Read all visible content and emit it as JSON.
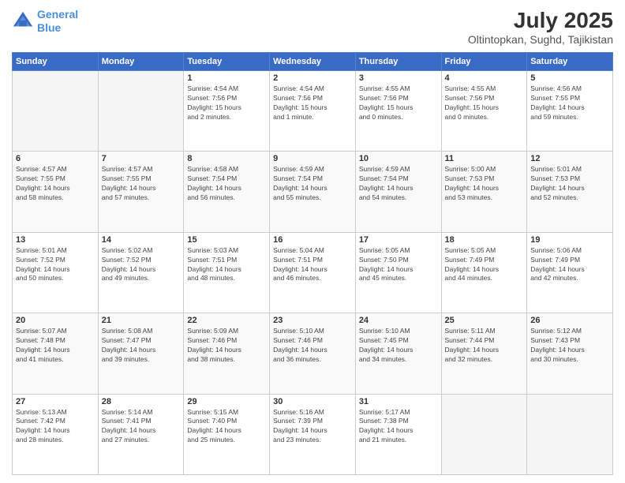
{
  "header": {
    "logo_line1": "General",
    "logo_line2": "Blue",
    "title": "July 2025",
    "subtitle": "Oltintopkan, Sughd, Tajikistan"
  },
  "weekdays": [
    "Sunday",
    "Monday",
    "Tuesday",
    "Wednesday",
    "Thursday",
    "Friday",
    "Saturday"
  ],
  "weeks": [
    [
      {
        "day": "",
        "info": ""
      },
      {
        "day": "",
        "info": ""
      },
      {
        "day": "1",
        "info": "Sunrise: 4:54 AM\nSunset: 7:56 PM\nDaylight: 15 hours\nand 2 minutes."
      },
      {
        "day": "2",
        "info": "Sunrise: 4:54 AM\nSunset: 7:56 PM\nDaylight: 15 hours\nand 1 minute."
      },
      {
        "day": "3",
        "info": "Sunrise: 4:55 AM\nSunset: 7:56 PM\nDaylight: 15 hours\nand 0 minutes."
      },
      {
        "day": "4",
        "info": "Sunrise: 4:55 AM\nSunset: 7:56 PM\nDaylight: 15 hours\nand 0 minutes."
      },
      {
        "day": "5",
        "info": "Sunrise: 4:56 AM\nSunset: 7:55 PM\nDaylight: 14 hours\nand 59 minutes."
      }
    ],
    [
      {
        "day": "6",
        "info": "Sunrise: 4:57 AM\nSunset: 7:55 PM\nDaylight: 14 hours\nand 58 minutes."
      },
      {
        "day": "7",
        "info": "Sunrise: 4:57 AM\nSunset: 7:55 PM\nDaylight: 14 hours\nand 57 minutes."
      },
      {
        "day": "8",
        "info": "Sunrise: 4:58 AM\nSunset: 7:54 PM\nDaylight: 14 hours\nand 56 minutes."
      },
      {
        "day": "9",
        "info": "Sunrise: 4:59 AM\nSunset: 7:54 PM\nDaylight: 14 hours\nand 55 minutes."
      },
      {
        "day": "10",
        "info": "Sunrise: 4:59 AM\nSunset: 7:54 PM\nDaylight: 14 hours\nand 54 minutes."
      },
      {
        "day": "11",
        "info": "Sunrise: 5:00 AM\nSunset: 7:53 PM\nDaylight: 14 hours\nand 53 minutes."
      },
      {
        "day": "12",
        "info": "Sunrise: 5:01 AM\nSunset: 7:53 PM\nDaylight: 14 hours\nand 52 minutes."
      }
    ],
    [
      {
        "day": "13",
        "info": "Sunrise: 5:01 AM\nSunset: 7:52 PM\nDaylight: 14 hours\nand 50 minutes."
      },
      {
        "day": "14",
        "info": "Sunrise: 5:02 AM\nSunset: 7:52 PM\nDaylight: 14 hours\nand 49 minutes."
      },
      {
        "day": "15",
        "info": "Sunrise: 5:03 AM\nSunset: 7:51 PM\nDaylight: 14 hours\nand 48 minutes."
      },
      {
        "day": "16",
        "info": "Sunrise: 5:04 AM\nSunset: 7:51 PM\nDaylight: 14 hours\nand 46 minutes."
      },
      {
        "day": "17",
        "info": "Sunrise: 5:05 AM\nSunset: 7:50 PM\nDaylight: 14 hours\nand 45 minutes."
      },
      {
        "day": "18",
        "info": "Sunrise: 5:05 AM\nSunset: 7:49 PM\nDaylight: 14 hours\nand 44 minutes."
      },
      {
        "day": "19",
        "info": "Sunrise: 5:06 AM\nSunset: 7:49 PM\nDaylight: 14 hours\nand 42 minutes."
      }
    ],
    [
      {
        "day": "20",
        "info": "Sunrise: 5:07 AM\nSunset: 7:48 PM\nDaylight: 14 hours\nand 41 minutes."
      },
      {
        "day": "21",
        "info": "Sunrise: 5:08 AM\nSunset: 7:47 PM\nDaylight: 14 hours\nand 39 minutes."
      },
      {
        "day": "22",
        "info": "Sunrise: 5:09 AM\nSunset: 7:46 PM\nDaylight: 14 hours\nand 38 minutes."
      },
      {
        "day": "23",
        "info": "Sunrise: 5:10 AM\nSunset: 7:46 PM\nDaylight: 14 hours\nand 36 minutes."
      },
      {
        "day": "24",
        "info": "Sunrise: 5:10 AM\nSunset: 7:45 PM\nDaylight: 14 hours\nand 34 minutes."
      },
      {
        "day": "25",
        "info": "Sunrise: 5:11 AM\nSunset: 7:44 PM\nDaylight: 14 hours\nand 32 minutes."
      },
      {
        "day": "26",
        "info": "Sunrise: 5:12 AM\nSunset: 7:43 PM\nDaylight: 14 hours\nand 30 minutes."
      }
    ],
    [
      {
        "day": "27",
        "info": "Sunrise: 5:13 AM\nSunset: 7:42 PM\nDaylight: 14 hours\nand 28 minutes."
      },
      {
        "day": "28",
        "info": "Sunrise: 5:14 AM\nSunset: 7:41 PM\nDaylight: 14 hours\nand 27 minutes."
      },
      {
        "day": "29",
        "info": "Sunrise: 5:15 AM\nSunset: 7:40 PM\nDaylight: 14 hours\nand 25 minutes."
      },
      {
        "day": "30",
        "info": "Sunrise: 5:16 AM\nSunset: 7:39 PM\nDaylight: 14 hours\nand 23 minutes."
      },
      {
        "day": "31",
        "info": "Sunrise: 5:17 AM\nSunset: 7:38 PM\nDaylight: 14 hours\nand 21 minutes."
      },
      {
        "day": "",
        "info": ""
      },
      {
        "day": "",
        "info": ""
      }
    ]
  ]
}
